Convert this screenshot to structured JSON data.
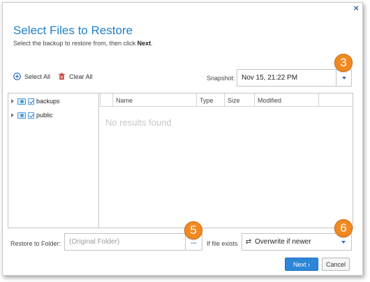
{
  "dialog": {
    "close_glyph": "×",
    "title": "Select Files to Restore",
    "subtitle_prefix": "Select the backup to restore from, then click ",
    "subtitle_bold": "Next",
    "subtitle_suffix": "."
  },
  "toolbar": {
    "select_all": "Select All",
    "clear_all": "Clear All"
  },
  "snapshot": {
    "label": "Snapshot:",
    "value": "Nov 15, 21:22 PM"
  },
  "tree": {
    "items": [
      {
        "label": "backups"
      },
      {
        "label": "public"
      }
    ]
  },
  "list": {
    "columns": [
      "Name",
      "Type",
      "Size",
      "Modified"
    ],
    "empty_text": "No results found"
  },
  "restore": {
    "label": "Restore to Folder:",
    "placeholder": "(Original Folder)",
    "browse": "..."
  },
  "if_exists": {
    "label": "If file exists",
    "value": "Overwrite if newer"
  },
  "buttons": {
    "next": "Next ›",
    "cancel": "Cancel"
  },
  "callouts": [
    "3",
    "5",
    "6"
  ],
  "colors": {
    "accent": "#1d80c8",
    "callout": "#f08a20",
    "primary_button": "#2d86d8"
  }
}
